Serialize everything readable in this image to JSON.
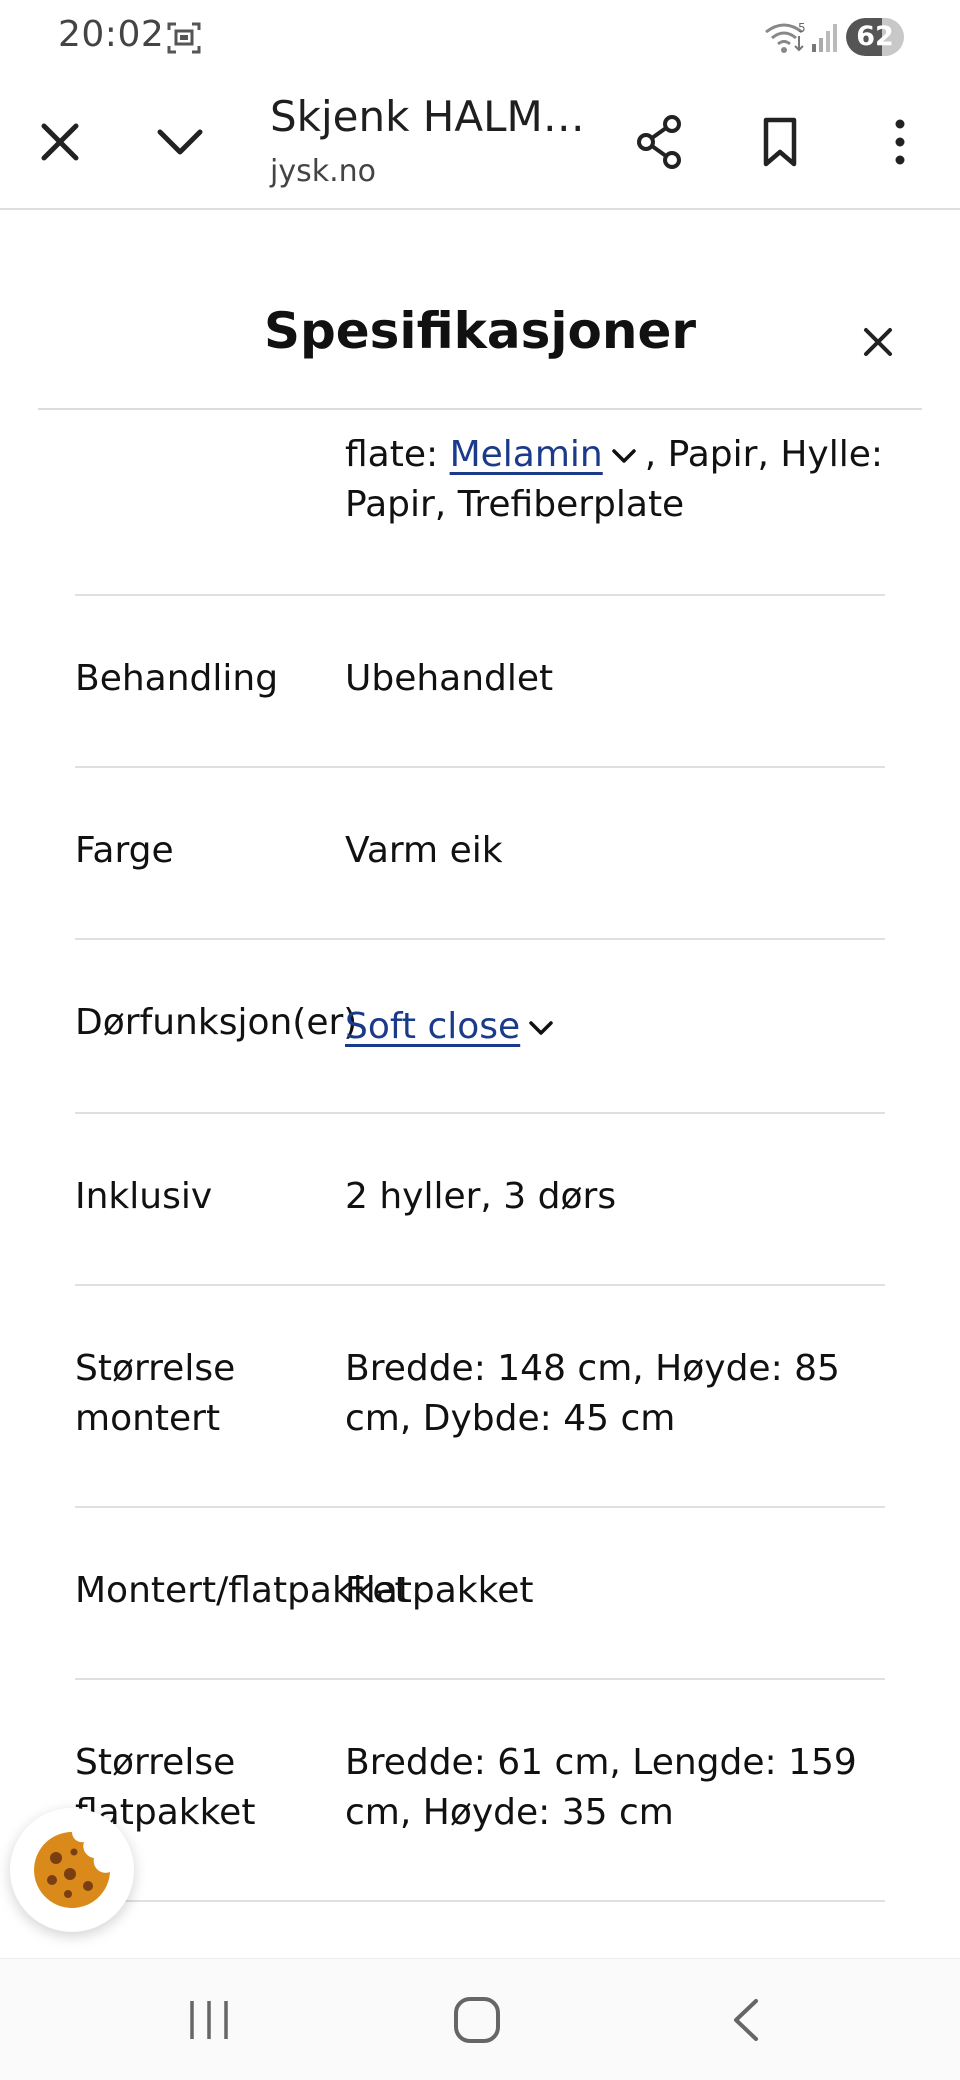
{
  "status_bar": {
    "time": "20:02",
    "battery_level": "62",
    "wifi_band": "5"
  },
  "browser": {
    "page_title": "Skjenk HALMS…",
    "site": "jysk.no"
  },
  "sheet": {
    "title": "Spesifikasjoner"
  },
  "specs": {
    "material_partial": {
      "prefix": "flate: ",
      "link": "Melamin",
      "suffix": ", Papir, Hylle: Papir, Trefiberplate"
    },
    "rows": [
      {
        "label": "Behandling",
        "value": "Ubehandlet"
      },
      {
        "label": "Farge",
        "value": "Varm eik"
      },
      {
        "label": "Dørfunksjon(er)",
        "value": "Soft close"
      },
      {
        "label": "Inklusiv",
        "value": "2 hyller, 3 dørs"
      },
      {
        "label": "Størrelse montert",
        "value": "Bredde: 148 cm, Høyde: 85 cm, Dybde: 45 cm"
      },
      {
        "label": "Montert/flatpakket",
        "value": "Flatpakket"
      },
      {
        "label": "Størrelse flatpakket",
        "value": "Bredde: 61 cm, Lengde: 159 cm, Høyde: 35 cm"
      }
    ]
  },
  "colors": {
    "link": "#1a3a8a",
    "divider": "#e0e0e0",
    "cookie": "#d98a1a"
  }
}
